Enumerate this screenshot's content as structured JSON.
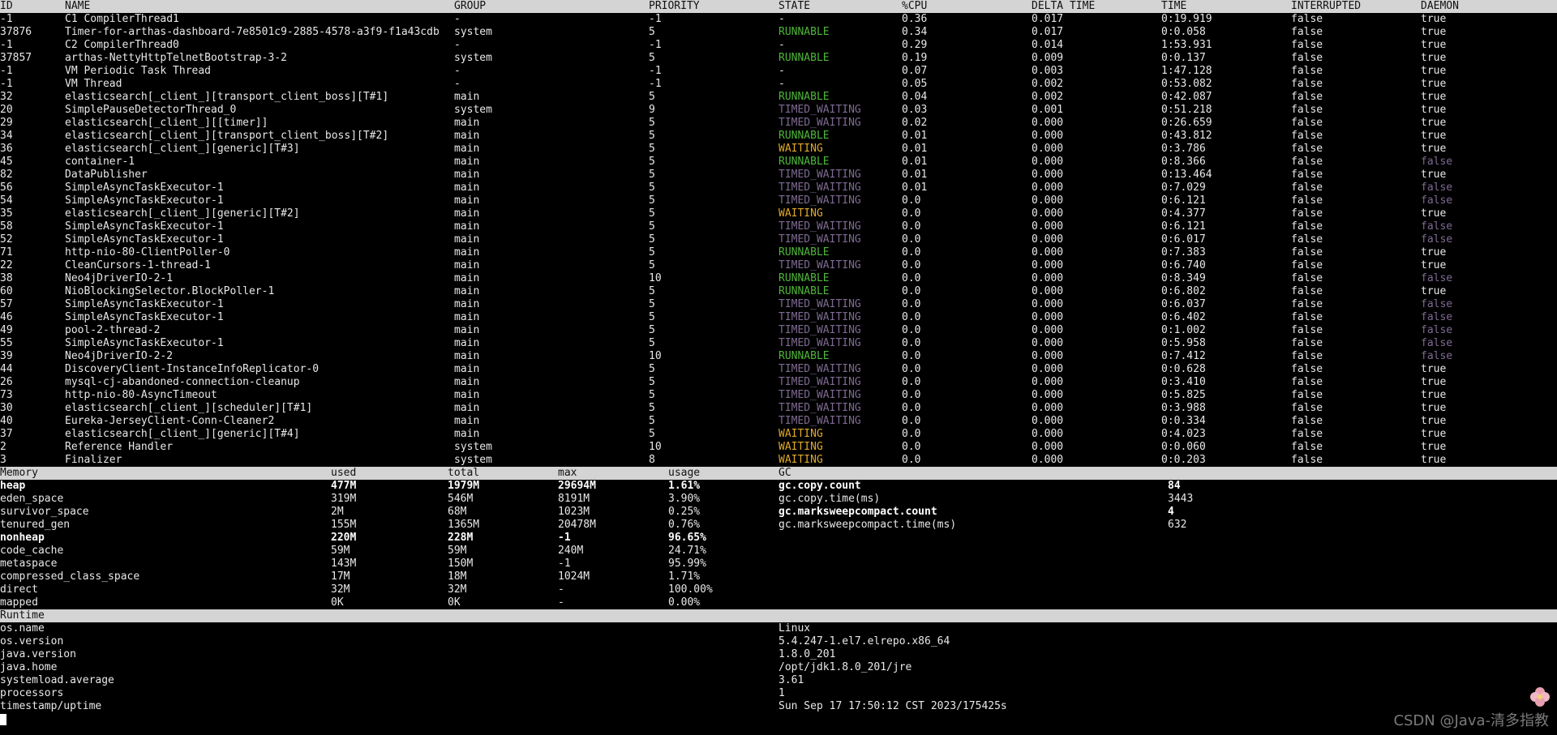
{
  "threads": {
    "headers": [
      "ID",
      "NAME",
      "GROUP",
      "PRIORITY",
      "STATE",
      "%CPU",
      "DELTA TIME",
      "TIME",
      "INTERRUPTED",
      "DAEMON"
    ],
    "rows": [
      [
        "-1",
        "C1 CompilerThread1",
        "-",
        "-1",
        "-",
        "0.36",
        "0.017",
        "0:19.919",
        "false",
        "true"
      ],
      [
        "37876",
        "Timer-for-arthas-dashboard-7e8501c9-2885-4578-a3f9-f1a43cdb",
        "system",
        "5",
        "RUNNABLE",
        "0.34",
        "0.017",
        "0:0.058",
        "false",
        "true"
      ],
      [
        "-1",
        "C2 CompilerThread0",
        "-",
        "-1",
        "-",
        "0.29",
        "0.014",
        "1:53.931",
        "false",
        "true"
      ],
      [
        "37857",
        "arthas-NettyHttpTelnetBootstrap-3-2",
        "system",
        "5",
        "RUNNABLE",
        "0.19",
        "0.009",
        "0:0.137",
        "false",
        "true"
      ],
      [
        "-1",
        "VM Periodic Task Thread",
        "-",
        "-1",
        "-",
        "0.07",
        "0.003",
        "1:47.128",
        "false",
        "true"
      ],
      [
        "-1",
        "VM Thread",
        "-",
        "-1",
        "-",
        "0.05",
        "0.002",
        "0:53.082",
        "false",
        "true"
      ],
      [
        "32",
        "elasticsearch[_client_][transport_client_boss][T#1]",
        "main",
        "5",
        "RUNNABLE",
        "0.04",
        "0.002",
        "0:42.087",
        "false",
        "true"
      ],
      [
        "20",
        "SimplePauseDetectorThread_0",
        "system",
        "9",
        "TIMED_WAITING",
        "0.03",
        "0.001",
        "0:51.218",
        "false",
        "true"
      ],
      [
        "29",
        "elasticsearch[_client_][[timer]]",
        "main",
        "5",
        "TIMED_WAITING",
        "0.02",
        "0.000",
        "0:26.659",
        "false",
        "true"
      ],
      [
        "34",
        "elasticsearch[_client_][transport_client_boss][T#2]",
        "main",
        "5",
        "RUNNABLE",
        "0.01",
        "0.000",
        "0:43.812",
        "false",
        "true"
      ],
      [
        "36",
        "elasticsearch[_client_][generic][T#3]",
        "main",
        "5",
        "WAITING",
        "0.01",
        "0.000",
        "0:3.786",
        "false",
        "true"
      ],
      [
        "45",
        "container-1",
        "main",
        "5",
        "RUNNABLE",
        "0.01",
        "0.000",
        "0:8.366",
        "false",
        "false"
      ],
      [
        "82",
        "DataPublisher",
        "main",
        "5",
        "TIMED_WAITING",
        "0.01",
        "0.000",
        "0:13.464",
        "false",
        "true"
      ],
      [
        "56",
        "SimpleAsyncTaskExecutor-1",
        "main",
        "5",
        "TIMED_WAITING",
        "0.01",
        "0.000",
        "0:7.029",
        "false",
        "false"
      ],
      [
        "54",
        "SimpleAsyncTaskExecutor-1",
        "main",
        "5",
        "TIMED_WAITING",
        "0.0",
        "0.000",
        "0:6.121",
        "false",
        "false"
      ],
      [
        "35",
        "elasticsearch[_client_][generic][T#2]",
        "main",
        "5",
        "WAITING",
        "0.0",
        "0.000",
        "0:4.377",
        "false",
        "true"
      ],
      [
        "58",
        "SimpleAsyncTaskExecutor-1",
        "main",
        "5",
        "TIMED_WAITING",
        "0.0",
        "0.000",
        "0:6.121",
        "false",
        "false"
      ],
      [
        "52",
        "SimpleAsyncTaskExecutor-1",
        "main",
        "5",
        "TIMED_WAITING",
        "0.0",
        "0.000",
        "0:6.017",
        "false",
        "false"
      ],
      [
        "71",
        "http-nio-80-ClientPoller-0",
        "main",
        "5",
        "RUNNABLE",
        "0.0",
        "0.000",
        "0:7.383",
        "false",
        "true"
      ],
      [
        "22",
        "CleanCursors-1-thread-1",
        "main",
        "5",
        "TIMED_WAITING",
        "0.0",
        "0.000",
        "0:6.740",
        "false",
        "true"
      ],
      [
        "38",
        "Neo4jDriverIO-2-1",
        "main",
        "10",
        "RUNNABLE",
        "0.0",
        "0.000",
        "0:8.349",
        "false",
        "false"
      ],
      [
        "60",
        "NioBlockingSelector.BlockPoller-1",
        "main",
        "5",
        "RUNNABLE",
        "0.0",
        "0.000",
        "0:6.802",
        "false",
        "true"
      ],
      [
        "57",
        "SimpleAsyncTaskExecutor-1",
        "main",
        "5",
        "TIMED_WAITING",
        "0.0",
        "0.000",
        "0:6.037",
        "false",
        "false"
      ],
      [
        "46",
        "SimpleAsyncTaskExecutor-1",
        "main",
        "5",
        "TIMED_WAITING",
        "0.0",
        "0.000",
        "0:6.402",
        "false",
        "false"
      ],
      [
        "49",
        "pool-2-thread-2",
        "main",
        "5",
        "TIMED_WAITING",
        "0.0",
        "0.000",
        "0:1.002",
        "false",
        "false"
      ],
      [
        "55",
        "SimpleAsyncTaskExecutor-1",
        "main",
        "5",
        "TIMED_WAITING",
        "0.0",
        "0.000",
        "0:5.958",
        "false",
        "false"
      ],
      [
        "39",
        "Neo4jDriverIO-2-2",
        "main",
        "10",
        "RUNNABLE",
        "0.0",
        "0.000",
        "0:7.412",
        "false",
        "false"
      ],
      [
        "44",
        "DiscoveryClient-InstanceInfoReplicator-0",
        "main",
        "5",
        "TIMED_WAITING",
        "0.0",
        "0.000",
        "0:0.628",
        "false",
        "true"
      ],
      [
        "26",
        "mysql-cj-abandoned-connection-cleanup",
        "main",
        "5",
        "TIMED_WAITING",
        "0.0",
        "0.000",
        "0:3.410",
        "false",
        "true"
      ],
      [
        "73",
        "http-nio-80-AsyncTimeout",
        "main",
        "5",
        "TIMED_WAITING",
        "0.0",
        "0.000",
        "0:5.825",
        "false",
        "true"
      ],
      [
        "30",
        "elasticsearch[_client_][scheduler][T#1]",
        "main",
        "5",
        "TIMED_WAITING",
        "0.0",
        "0.000",
        "0:3.988",
        "false",
        "true"
      ],
      [
        "40",
        "Eureka-JerseyClient-Conn-Cleaner2",
        "main",
        "5",
        "TIMED_WAITING",
        "0.0",
        "0.000",
        "0:0.334",
        "false",
        "true"
      ],
      [
        "37",
        "elasticsearch[_client_][generic][T#4]",
        "main",
        "5",
        "WAITING",
        "0.0",
        "0.000",
        "0:4.023",
        "false",
        "true"
      ],
      [
        "2",
        "Reference Handler",
        "system",
        "10",
        "WAITING",
        "0.0",
        "0.000",
        "0:0.060",
        "false",
        "true"
      ],
      [
        "3",
        "Finalizer",
        "system",
        "8",
        "WAITING",
        "0.0",
        "0.000",
        "0:0.203",
        "false",
        "true"
      ]
    ]
  },
  "memory": {
    "headers": [
      "Memory",
      "used",
      "total",
      "max",
      "usage"
    ],
    "rows": [
      {
        "name": "heap",
        "used": "477M",
        "total": "1979M",
        "max": "29694M",
        "usage": "1.61%",
        "bold": true
      },
      {
        "name": "eden_space",
        "used": "319M",
        "total": "546M",
        "max": "8191M",
        "usage": "3.90%"
      },
      {
        "name": "survivor_space",
        "used": "2M",
        "total": "68M",
        "max": "1023M",
        "usage": "0.25%"
      },
      {
        "name": "tenured_gen",
        "used": "155M",
        "total": "1365M",
        "max": "20478M",
        "usage": "0.76%"
      },
      {
        "name": "nonheap",
        "used": "220M",
        "total": "228M",
        "max": "-1",
        "usage": "96.65%",
        "bold": true
      },
      {
        "name": "code_cache",
        "used": "59M",
        "total": "59M",
        "max": "240M",
        "usage": "24.71%"
      },
      {
        "name": "metaspace",
        "used": "143M",
        "total": "150M",
        "max": "-1",
        "usage": "95.99%"
      },
      {
        "name": "compressed_class_space",
        "used": "17M",
        "total": "18M",
        "max": "1024M",
        "usage": "1.71%"
      },
      {
        "name": "direct",
        "used": "32M",
        "total": "32M",
        "max": "-",
        "usage": "100.00%"
      },
      {
        "name": "mapped",
        "used": "0K",
        "total": "0K",
        "max": "-",
        "usage": "0.00%"
      }
    ]
  },
  "gc": {
    "header": "GC",
    "rows": [
      {
        "key": "gc.copy.count",
        "value": "84",
        "bold": true
      },
      {
        "key": "gc.copy.time(ms)",
        "value": "3443"
      },
      {
        "key": "gc.marksweepcompact.count",
        "value": "4",
        "bold": true
      },
      {
        "key": "gc.marksweepcompact.time(ms)",
        "value": "632"
      }
    ]
  },
  "runtime": {
    "header": "Runtime",
    "rows": [
      {
        "key": "os.name",
        "value": "Linux"
      },
      {
        "key": "os.version",
        "value": "5.4.247-1.el7.elrepo.x86_64"
      },
      {
        "key": "java.version",
        "value": "1.8.0_201"
      },
      {
        "key": "java.home",
        "value": "/opt/jdk1.8.0_201/jre"
      },
      {
        "key": "systemload.average",
        "value": "3.61"
      },
      {
        "key": "processors",
        "value": "1"
      },
      {
        "key": "timestamp/uptime",
        "value": "Sun Sep 17 17:50:12 CST 2023/175425s"
      }
    ]
  },
  "watermark": "CSDN @Java-清多指教",
  "colors": {
    "header_bg": "#d4d4d4",
    "runnable": "#4fb63a",
    "timed_waiting": "#7e6a92",
    "waiting": "#e0a92a"
  }
}
